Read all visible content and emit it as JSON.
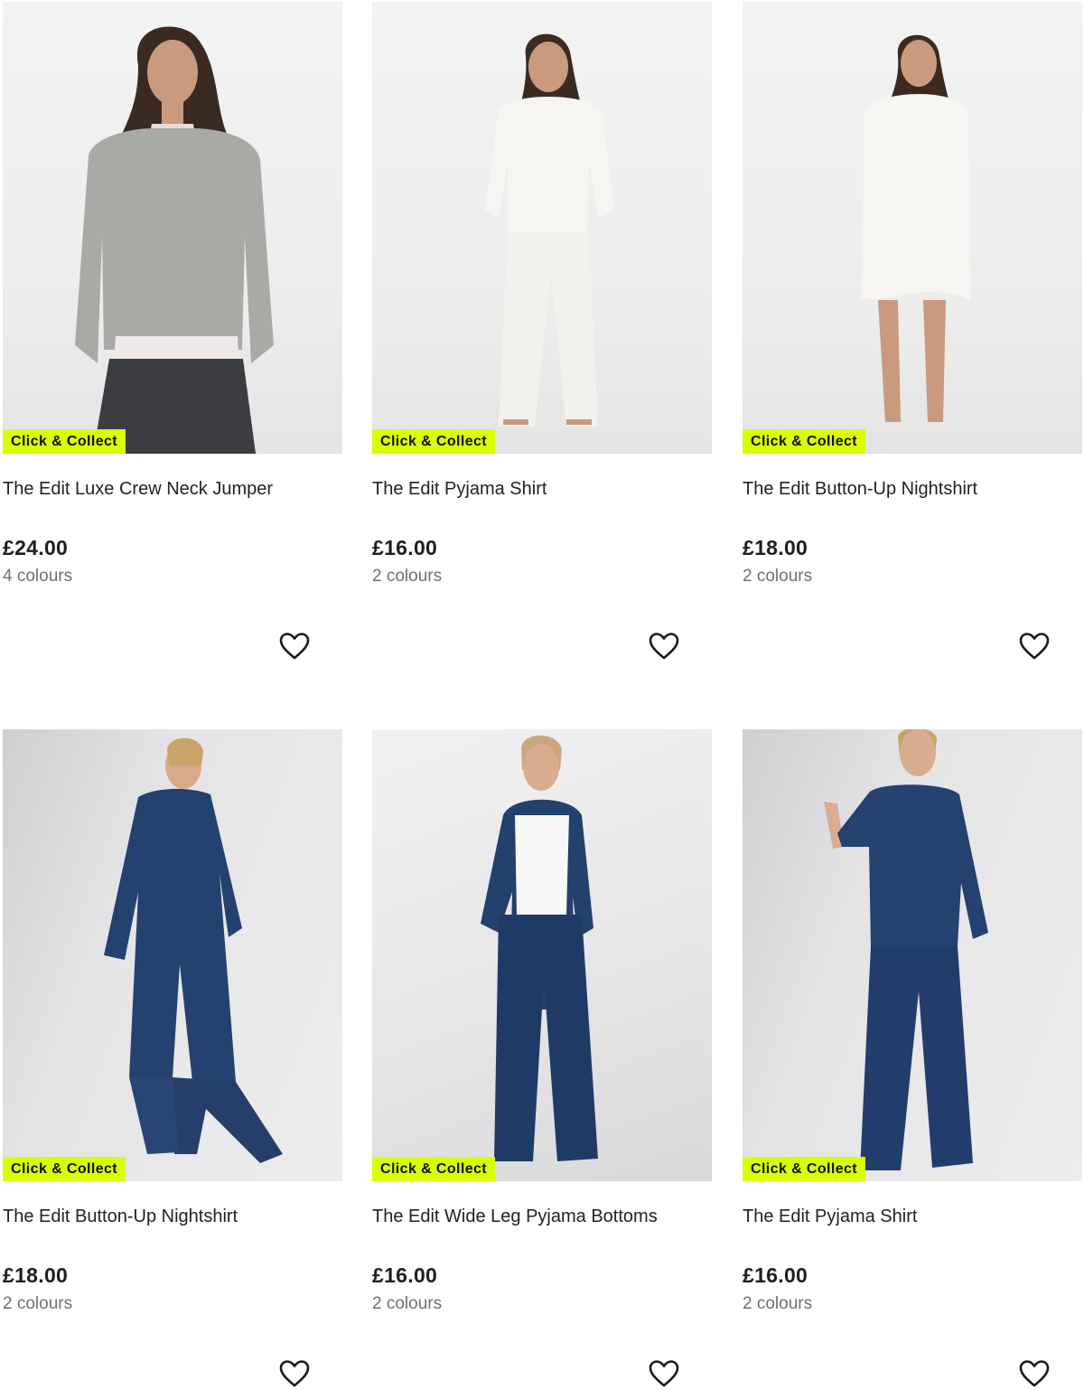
{
  "badge_color": "#d9ff00",
  "products": [
    {
      "badge": "Click & Collect",
      "title": "The Edit Luxe Crew Neck Jumper",
      "price": "£24.00",
      "colours": "4 colours",
      "image": "grey-jumper-model"
    },
    {
      "badge": "Click & Collect",
      "title": "The Edit Pyjama Shirt",
      "price": "£16.00",
      "colours": "2 colours",
      "image": "white-pyjama-set-model"
    },
    {
      "badge": "Click & Collect",
      "title": "The Edit Button-Up Nightshirt",
      "price": "£18.00",
      "colours": "2 colours",
      "image": "white-nightshirt-model"
    },
    {
      "badge": "Click & Collect",
      "title": "The Edit Button-Up Nightshirt",
      "price": "£18.00",
      "colours": "2 colours",
      "image": "navy-pyjama-leaning-model"
    },
    {
      "badge": "Click & Collect",
      "title": "The Edit Wide Leg Pyjama Bottoms",
      "price": "£16.00",
      "colours": "2 colours",
      "image": "navy-pyjama-bottoms-model"
    },
    {
      "badge": "Click & Collect",
      "title": "The Edit Pyjama Shirt",
      "price": "£16.00",
      "colours": "2 colours",
      "image": "navy-pyjama-shirt-model"
    }
  ]
}
